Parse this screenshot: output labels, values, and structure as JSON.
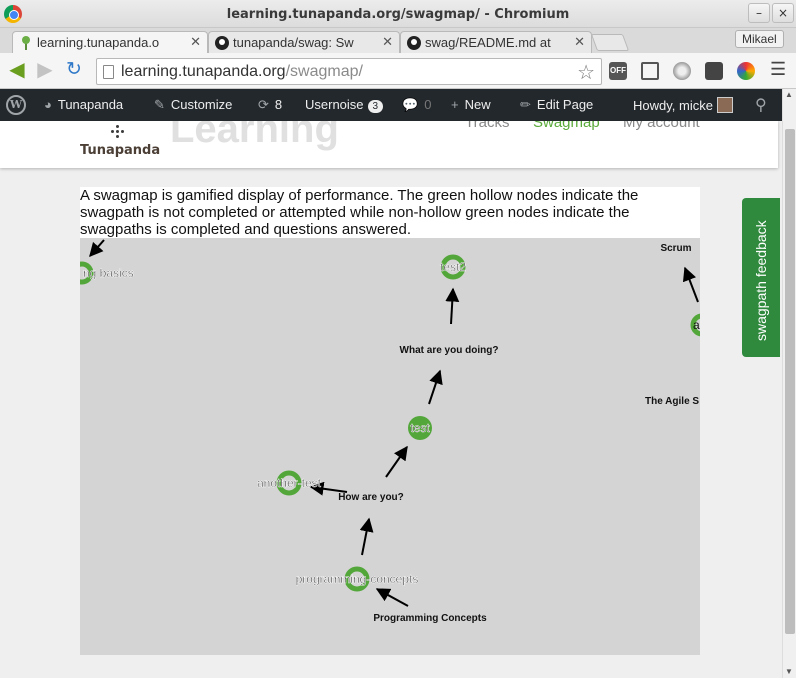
{
  "window": {
    "title": "learning.tunapanda.org/swagmap/ - Chromium"
  },
  "tabs": [
    {
      "title": "learning.tunapanda.o",
      "active": true,
      "icon": "tunapanda-tree-icon"
    },
    {
      "title": "tunapanda/swag: Sw",
      "active": false,
      "icon": "github-icon"
    },
    {
      "title": "swag/README.md at",
      "active": false,
      "icon": "github-icon"
    }
  ],
  "profile": {
    "name": "Mikael"
  },
  "omnibox": {
    "domain": "learning.tunapanda.org",
    "path": "/swagmap/"
  },
  "extensions": {
    "off_label": "OFF"
  },
  "wpbar": {
    "site_name": "Tunapanda",
    "customize": "Customize",
    "updates_count": "8",
    "usernoise": "Usernoise",
    "usernoise_count": "3",
    "comments_count": "0",
    "new": "New",
    "edit_page": "Edit Page",
    "howdy": "Howdy, micke"
  },
  "site": {
    "logo_text": "Tunapanda",
    "title": "Learning",
    "nav": [
      {
        "label": "Tracks",
        "active": false
      },
      {
        "label": "Swagmap",
        "active": true
      },
      {
        "label": "My account",
        "active": false
      }
    ]
  },
  "content": {
    "description": "A swagmap is gamified display of performance. The green hollow nodes indicate the swagpath is not completed or attempted while non-hollow green nodes indicate the swagpaths is completed and questions answered."
  },
  "swagmap": {
    "colors": {
      "node": "#53a73a",
      "edge": "#000000",
      "background": "#d4d4d4"
    },
    "nodes": [
      {
        "id": "basics",
        "label": "ng basics",
        "hollow": true
      },
      {
        "id": "test2",
        "label": "test2",
        "hollow": true
      },
      {
        "id": "test",
        "label": "test",
        "hollow": false
      },
      {
        "id": "another-test",
        "label": "another-test",
        "hollow": true
      },
      {
        "id": "programming-concepts",
        "label": "programming-concepts",
        "hollow": true
      },
      {
        "id": "agile",
        "label": "a",
        "hollow": true
      }
    ],
    "edge_labels": [
      {
        "id": "what",
        "label": "What are you doing?"
      },
      {
        "id": "how",
        "label": "How are you?"
      },
      {
        "id": "prog",
        "label": "Programming Concepts"
      },
      {
        "id": "scrum",
        "label": "Scrum"
      },
      {
        "id": "agile-s",
        "label": "The Agile S"
      }
    ]
  },
  "feedback": {
    "label": "swagpath feedback"
  }
}
